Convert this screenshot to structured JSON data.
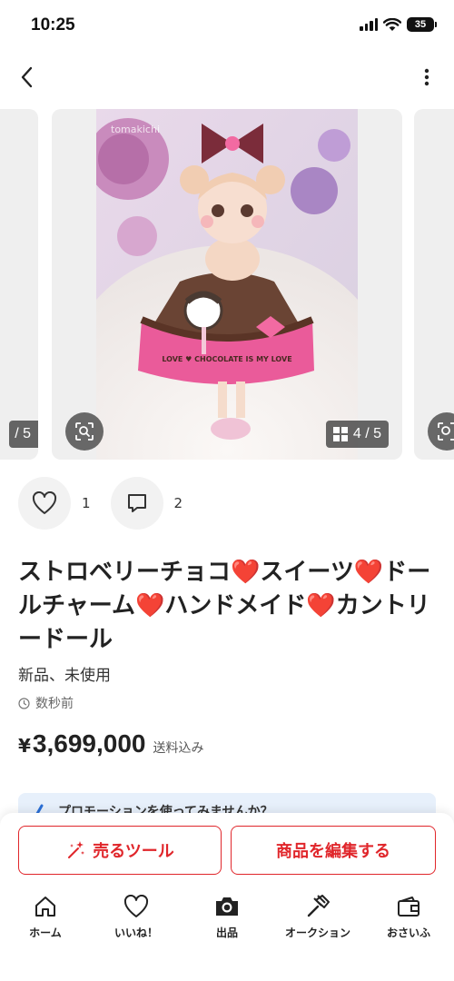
{
  "status": {
    "time": "10:25",
    "battery": "35"
  },
  "header": {
    "back_icon": "chevron-left-icon",
    "more_icon": "more-vertical-icon"
  },
  "carousel": {
    "prev_counter": "/ 5",
    "counter": "4 / 5",
    "watermark": "tomakichi",
    "item_text": "LOVE ♥ CHOCOLATE IS MY LOVE"
  },
  "reactions": {
    "likes": "1",
    "comments": "2"
  },
  "item": {
    "title_parts": [
      "ストロベリーチョコ",
      "❤️",
      "スイーツ",
      "❤️",
      "ドールチャーム",
      "❤️",
      "ハンドメイド",
      "❤️",
      "カントリードール"
    ],
    "condition": "新品、未使用",
    "posted": "数秒前",
    "currency": "¥",
    "price": "3,699,000",
    "shipping": "送料込み"
  },
  "promo": {
    "text": "プロモーションを使ってみませんか？"
  },
  "actions": {
    "sell_tool": "売るツール",
    "edit_item": "商品を編集する"
  },
  "tabbar": {
    "home": "ホーム",
    "likes": "いいね！",
    "sell": "出品",
    "auction": "オークション",
    "wallet": "おさいふ"
  },
  "colors": {
    "accent": "#e0262b",
    "promo_bg": "#e7f0fb"
  }
}
